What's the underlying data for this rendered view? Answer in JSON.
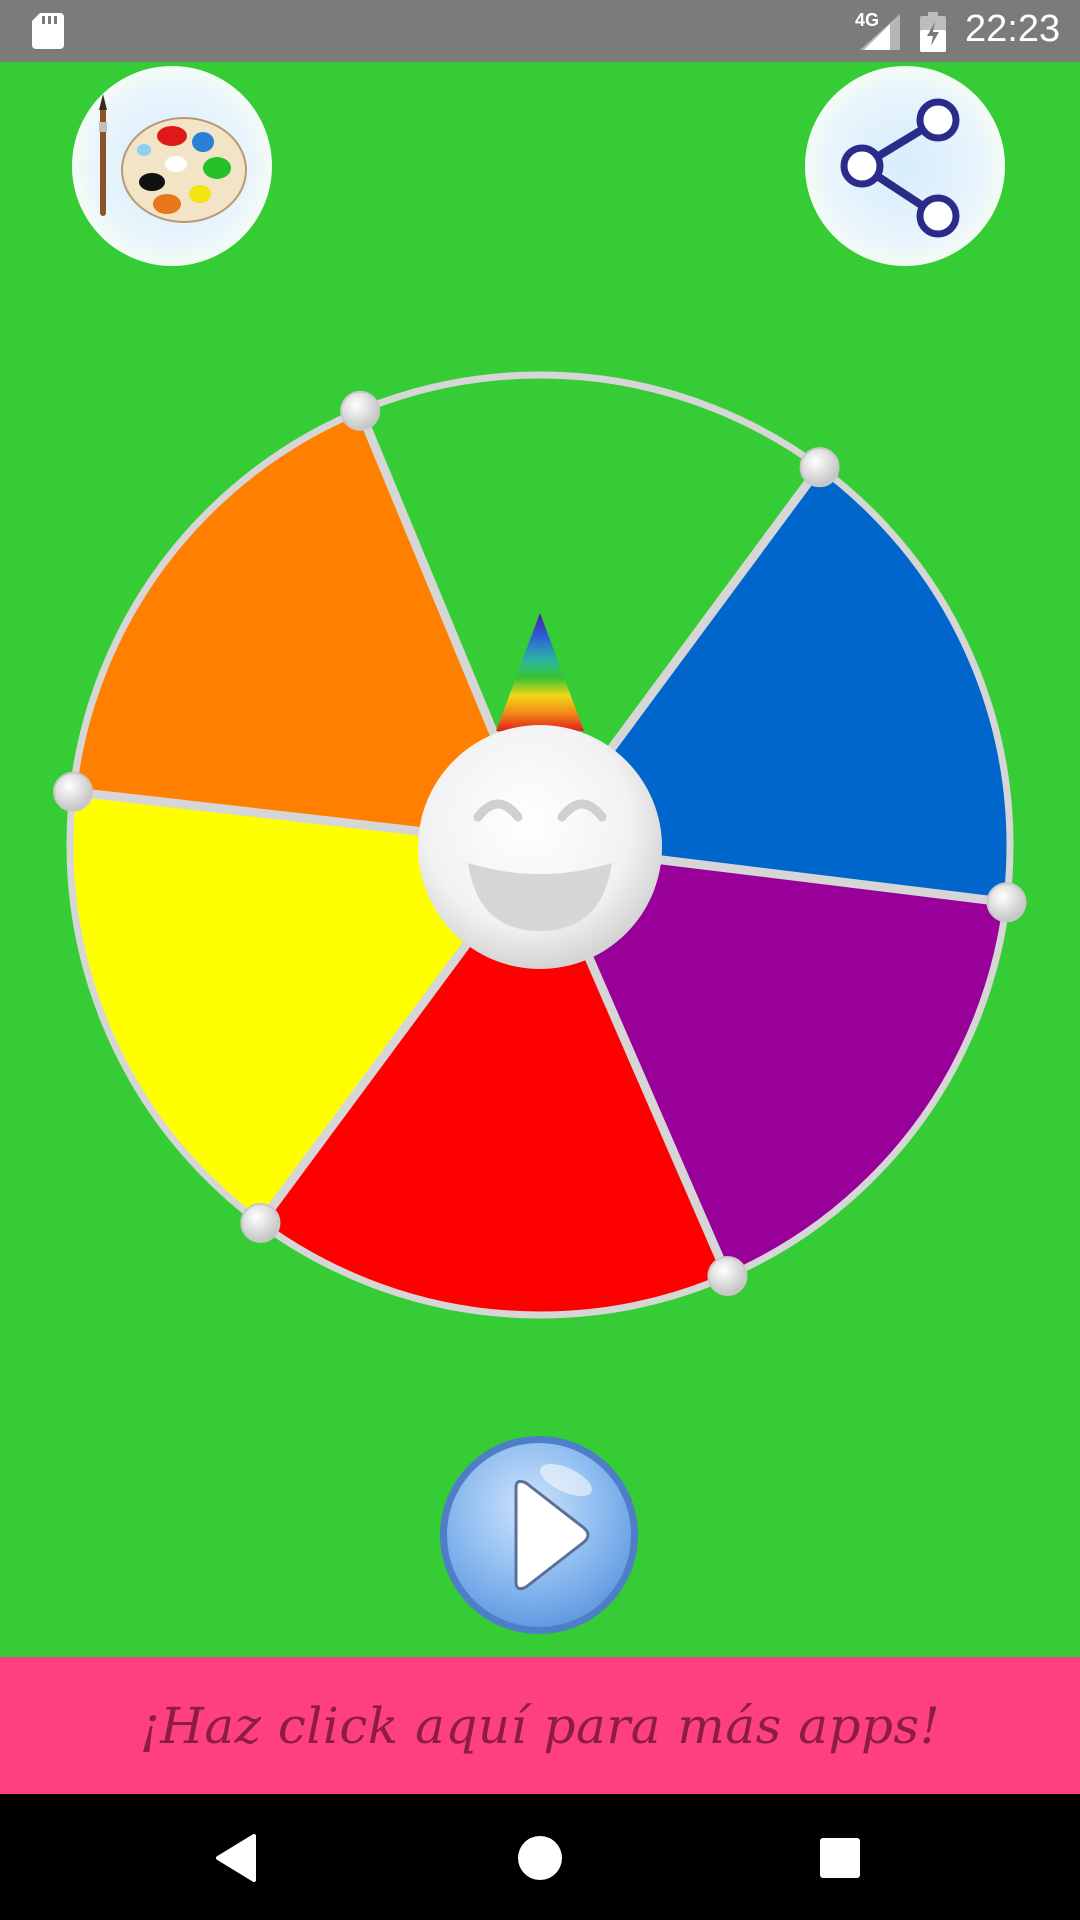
{
  "status_bar": {
    "network": "4G",
    "time": "22:23"
  },
  "icons": {
    "sd_card": "sd-card-icon",
    "signal": "signal-icon",
    "battery": "battery-charging-icon",
    "palette": "palette-icon",
    "share": "share-icon",
    "smiley": "smiley-face-icon",
    "pointer": "rainbow-pointer-icon",
    "play": "play-icon",
    "nav_back": "back-icon",
    "nav_home": "home-icon",
    "nav_recents": "recents-icon"
  },
  "wheel": {
    "segments": [
      {
        "name": "green",
        "color": "#35cc35"
      },
      {
        "name": "blue",
        "color": "#0066cc"
      },
      {
        "name": "purple",
        "color": "#990099"
      },
      {
        "name": "red",
        "color": "#ff0000"
      },
      {
        "name": "yellow",
        "color": "#ffff00"
      },
      {
        "name": "orange",
        "color": "#ff8000"
      }
    ]
  },
  "banner": {
    "text": "¡Haz click aquí para más apps!",
    "background": "#fe4081",
    "text_color": "#8c1c46"
  },
  "colors": {
    "background": "#35cc35",
    "status_bar": "#7b7b7b",
    "nav_bar": "#000000"
  }
}
